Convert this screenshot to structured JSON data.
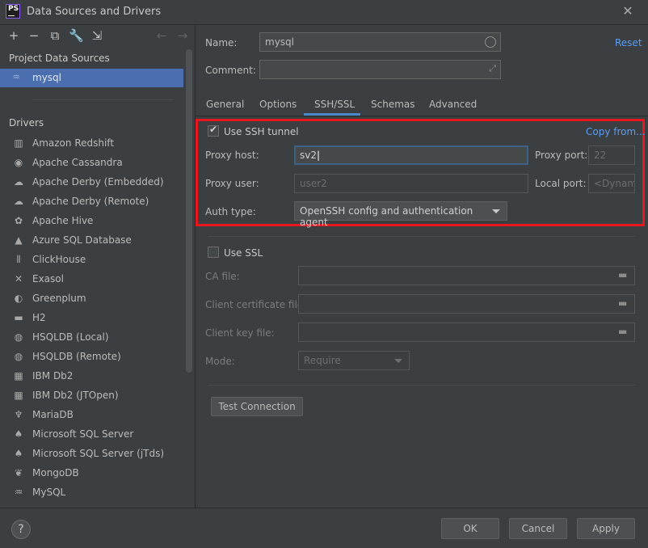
{
  "window": {
    "title": "Data Sources and Drivers",
    "app_icon_text": "PS"
  },
  "left": {
    "toolbar": [
      {
        "name": "add-icon",
        "glyph": "+"
      },
      {
        "name": "remove-icon",
        "glyph": "−"
      },
      {
        "name": "duplicate-icon",
        "glyph": "⧉"
      },
      {
        "name": "wrench-icon",
        "glyph": "🔧"
      },
      {
        "name": "import-icon",
        "glyph": "⇲"
      },
      {
        "name": "back-arrow-icon",
        "glyph": "←"
      },
      {
        "name": "forward-arrow-icon",
        "glyph": "→"
      }
    ],
    "project_heading": "Project Data Sources",
    "selected_source": "mysql",
    "drivers_heading": "Drivers",
    "drivers": [
      {
        "label": "Amazon Redshift",
        "icon": "redshift-icon",
        "glyph": "▥"
      },
      {
        "label": "Apache Cassandra",
        "icon": "cassandra-icon",
        "glyph": "◉"
      },
      {
        "label": "Apache Derby (Embedded)",
        "icon": "derby-icon",
        "glyph": "☁"
      },
      {
        "label": "Apache Derby (Remote)",
        "icon": "derby-icon",
        "glyph": "☁"
      },
      {
        "label": "Apache Hive",
        "icon": "hive-icon",
        "glyph": "✿"
      },
      {
        "label": "Azure SQL Database",
        "icon": "azure-icon",
        "glyph": "▲"
      },
      {
        "label": "ClickHouse",
        "icon": "clickhouse-icon",
        "glyph": "⦀"
      },
      {
        "label": "Exasol",
        "icon": "exasol-icon",
        "glyph": "✕"
      },
      {
        "label": "Greenplum",
        "icon": "greenplum-icon",
        "glyph": "◐"
      },
      {
        "label": "H2",
        "icon": "h2-icon",
        "glyph": "▬"
      },
      {
        "label": "HSQLDB (Local)",
        "icon": "hsqldb-icon",
        "glyph": "◍"
      },
      {
        "label": "HSQLDB (Remote)",
        "icon": "hsqldb-icon",
        "glyph": "◍"
      },
      {
        "label": "IBM Db2",
        "icon": "ibm-db2-icon",
        "glyph": "▦"
      },
      {
        "label": "IBM Db2 (JTOpen)",
        "icon": "ibm-db2-icon",
        "glyph": "▦"
      },
      {
        "label": "MariaDB",
        "icon": "mariadb-icon",
        "glyph": "♆"
      },
      {
        "label": "Microsoft SQL Server",
        "icon": "mssql-icon",
        "glyph": "♠"
      },
      {
        "label": "Microsoft SQL Server (jTds)",
        "icon": "mssql-icon",
        "glyph": "♠"
      },
      {
        "label": "MongoDB",
        "icon": "mongodb-icon",
        "glyph": "❦"
      },
      {
        "label": "MySQL",
        "icon": "mysql-icon",
        "glyph": "♒"
      }
    ]
  },
  "form": {
    "name_label": "Name:",
    "name_value": "mysql",
    "reset_label": "Reset",
    "comment_label": "Comment:",
    "comment_value": "",
    "tabs": [
      "General",
      "Options",
      "SSH/SSL",
      "Schemas",
      "Advanced"
    ],
    "active_tab": "SSH/SSL",
    "ssh": {
      "use_ssh_label": "Use SSH tunnel",
      "use_ssh_checked": true,
      "copy_from_label": "Copy from...",
      "proxy_host_label": "Proxy host:",
      "proxy_host_value": "sv2",
      "proxy_port_label": "Proxy port:",
      "proxy_port_value": "22",
      "proxy_user_label": "Proxy user:",
      "proxy_user_placeholder": "user2",
      "local_port_label": "Local port:",
      "local_port_placeholder": "<Dynami",
      "auth_type_label": "Auth type:",
      "auth_type_value": "OpenSSH config and authentication agent"
    },
    "ssl": {
      "use_ssl_label": "Use SSL",
      "use_ssl_checked": false,
      "ca_file_label": "CA file:",
      "client_cert_label": "Client certificate file:",
      "client_key_label": "Client key file:",
      "mode_label": "Mode:",
      "mode_value": "Require"
    },
    "test_connection_label": "Test Connection"
  },
  "footer": {
    "help": "?",
    "ok": "OK",
    "cancel": "Cancel",
    "apply": "Apply"
  },
  "colors": {
    "highlight_box": "#e8171f",
    "accent": "#4a88c7",
    "selection": "#4b6eaf"
  }
}
